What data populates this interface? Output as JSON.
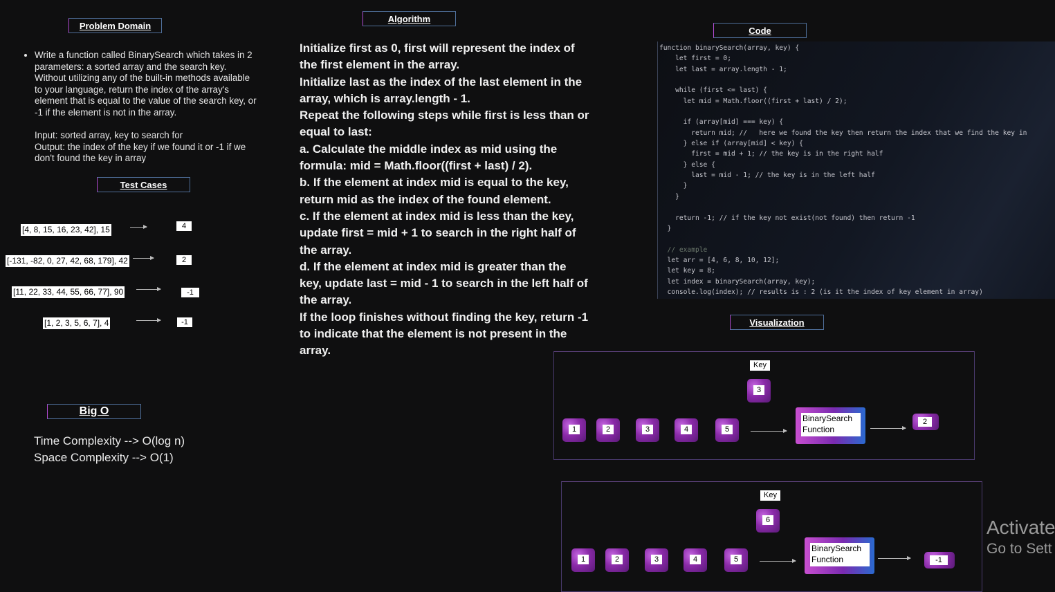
{
  "headers": {
    "problem_domain": "Problem Domain",
    "algorithm": "Algorithm",
    "code": "Code",
    "test_cases": "Test Cases",
    "visualization": "Visualization",
    "big_o": "Big O"
  },
  "problem_domain": {
    "bullet": "Write a function called BinarySearch which takes in 2 parameters: a sorted array and the search key. Without utilizing any of the built-in methods available to your language, return the index of the array's element that is equal to the value of the search key, or -1 if the element is not in the array.",
    "input": "Input: sorted array, key to search for",
    "output": "Output: the index of the key if we found it or -1 if we don't found the key in array"
  },
  "test_cases": [
    {
      "input": "[4, 8, 15, 16, 23, 42], 15",
      "output": "4"
    },
    {
      "input": "[-131, -82, 0, 27, 42, 68, 179], 42",
      "output": "2"
    },
    {
      "input": "[11, 22, 33, 44, 55, 66, 77], 90",
      "output": "-1"
    },
    {
      "input": "[1, 2, 3, 5, 6, 7], 4",
      "output": "-1"
    }
  ],
  "algorithm": [
    "Initialize first as 0,  first will represent the index of the first element in the array.",
    "Initialize last as the index of the last element in the array, which is array.length - 1.",
    "Repeat the following steps while first is less than or equal to last:",
    "a. Calculate the middle index as mid using the formula: mid = Math.floor((first + last) / 2).",
    "b. If the element at index mid is equal to the key, return mid as the index of the found element.",
    "c. If the element at index mid is less than the key, update first = mid + 1 to search in the right half of the array.",
    "d. If the element at index mid is greater than the key, update last = mid - 1 to search in the left half of the array.",
    "If the loop finishes without finding the key, return -1 to indicate that the element is not present in the array."
  ],
  "code_lines": [
    "function binarySearch(array, key) {",
    "    let first = 0;",
    "    let last = array.length - 1;",
    "",
    "    while (first <= last) {",
    "      let mid = Math.floor((first + last) / 2);",
    "",
    "      if (array[mid] === key) {",
    "        return mid; //   here we found the key then return the index that we find the key in",
    "      } else if (array[mid] < key) {",
    "        first = mid + 1; // the key is in the right half",
    "      } else {",
    "        last = mid - 1; // the key is in the left half",
    "      }",
    "    }",
    "",
    "    return -1; // if the key not exist(not found) then return -1",
    "  }",
    "",
    "  // example",
    "  let arr = [4, 6, 8, 10, 12];",
    "  let key = 8;",
    "  let index = binarySearch(array, key);",
    "  console.log(index); // results is : 2 (is it the index of key element in array)"
  ],
  "big_o": {
    "time": "Time Complexity --> O(log n)",
    "space": "Space Complexity -->  O(1)"
  },
  "visualizations": [
    {
      "key_label": "Key",
      "key_value": "3",
      "nodes": [
        "1",
        "2",
        "3",
        "4",
        "5"
      ],
      "function_label": "BinarySearch Function",
      "result": "2"
    },
    {
      "key_label": "Key",
      "key_value": "6",
      "nodes": [
        "1",
        "2",
        "3",
        "4",
        "5"
      ],
      "function_label": "BinarySearch Function",
      "result": "-1"
    }
  ],
  "watermark": {
    "line1": "Activate",
    "line2": "Go to Sett"
  }
}
